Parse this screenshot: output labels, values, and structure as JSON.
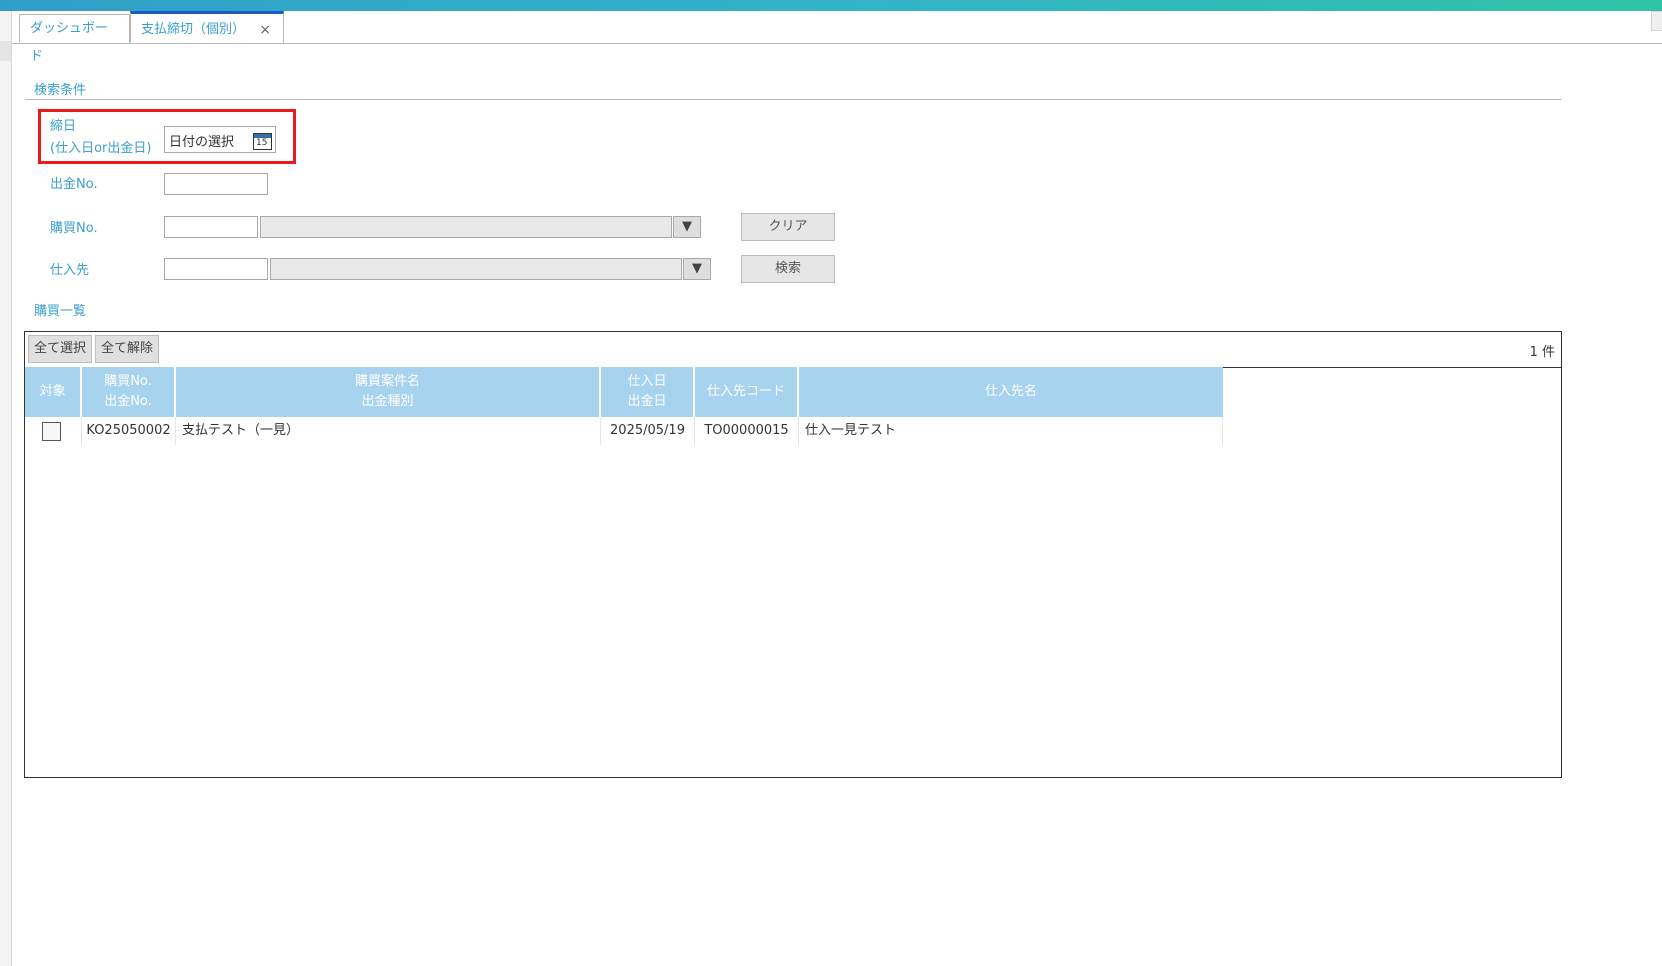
{
  "tabs": [
    {
      "label": "ダッシュボード"
    },
    {
      "label": "支払締切（個別）",
      "close": "×"
    }
  ],
  "search": {
    "section_title": "検索条件",
    "closing_date_label_1": "締日",
    "closing_date_label_2": "(仕入日or出金日)",
    "date_placeholder": "日付の選択",
    "calendar_day": "15",
    "payment_no_label": "出金No.",
    "purchase_no_label": "購買No.",
    "supplier_label": "仕入先",
    "clear_button": "クリア",
    "search_button": "検索",
    "dropdown_glyph": "▼"
  },
  "list": {
    "section_title": "購買一覧",
    "select_all": "全て選択",
    "deselect_all": "全て解除",
    "count": "1 件",
    "columns": [
      {
        "line1": "対象",
        "line2": ""
      },
      {
        "line1": "購買No.",
        "line2": "出金No."
      },
      {
        "line1": "購買案件名",
        "line2": "出金種別"
      },
      {
        "line1": "仕入日",
        "line2": "出金日"
      },
      {
        "line1": "仕入先コード",
        "line2": ""
      },
      {
        "line1": "仕入先名",
        "line2": ""
      }
    ],
    "rows": [
      {
        "purchase_no": "KO25050002",
        "project_name": "支払テスト（一見）",
        "date": "2025/05/19",
        "supplier_code": "TO00000015",
        "supplier_name": "仕入一見テスト",
        "checked": false
      }
    ]
  }
}
